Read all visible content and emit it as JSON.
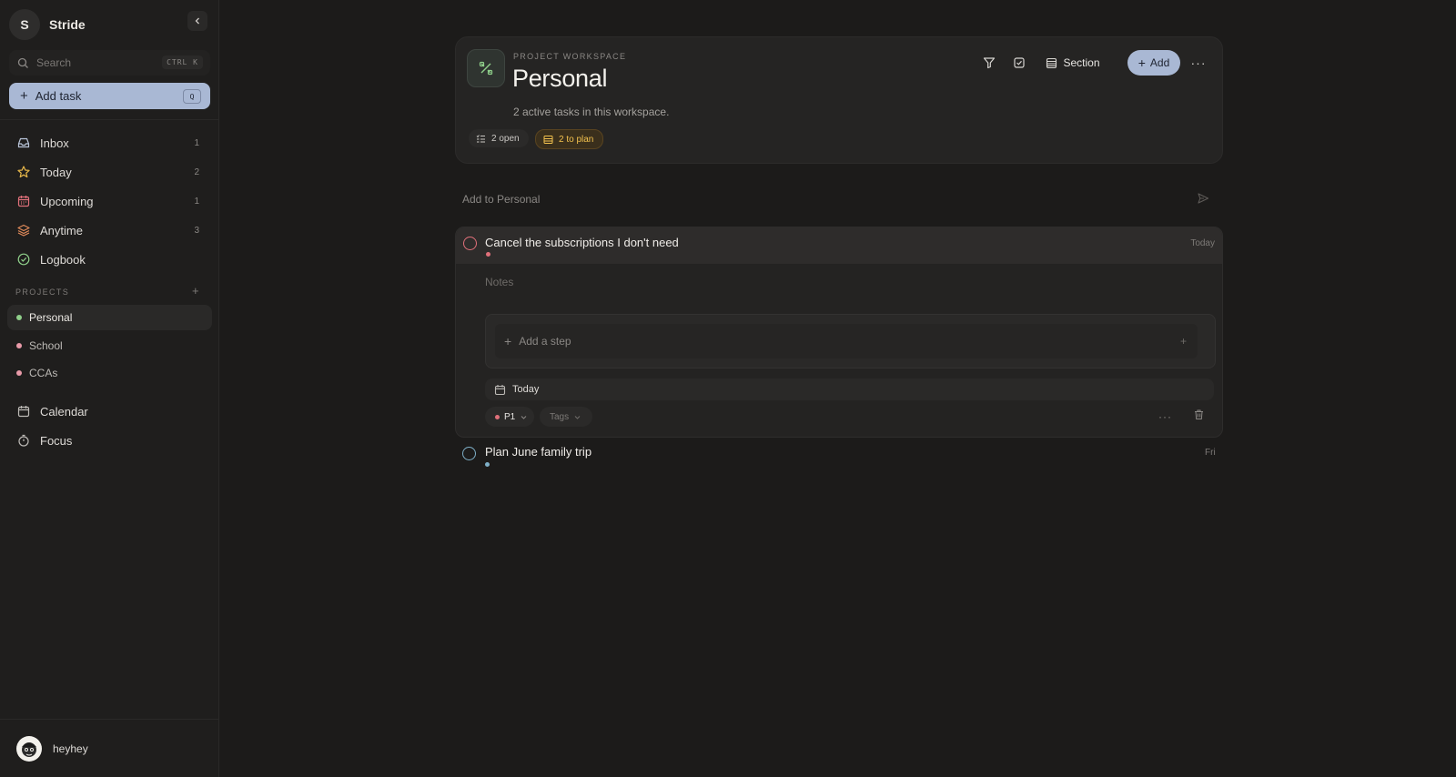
{
  "app": {
    "brand_initial": "S",
    "brand_name": "Stride"
  },
  "search": {
    "placeholder": "Search",
    "shortcut": "CTRL K"
  },
  "add_task": {
    "label": "Add task",
    "shortcut": "Q"
  },
  "nav": [
    {
      "label": "Inbox",
      "count": "1",
      "icon": "inbox-icon",
      "color": "#b8c4d8"
    },
    {
      "label": "Today",
      "count": "2",
      "icon": "star-icon",
      "color": "#e8b84a"
    },
    {
      "label": "Upcoming",
      "count": "1",
      "icon": "calendar-icon",
      "color": "#e0707a"
    },
    {
      "label": "Anytime",
      "count": "3",
      "icon": "layers-icon",
      "color": "#e08a5a"
    },
    {
      "label": "Logbook",
      "count": "",
      "icon": "check-circle-icon",
      "color": "#8fcf8a"
    }
  ],
  "projects_label": "PROJECTS",
  "projects": [
    {
      "label": "Personal",
      "color": "#8fcf8a",
      "active": true
    },
    {
      "label": "School",
      "color": "#e89aa8",
      "active": false
    },
    {
      "label": "CCAs",
      "color": "#e89aa8",
      "active": false
    }
  ],
  "bottom_nav": [
    {
      "label": "Calendar",
      "icon": "calendar-icon"
    },
    {
      "label": "Focus",
      "icon": "timer-icon"
    }
  ],
  "user": {
    "name": "heyhey"
  },
  "header": {
    "eyebrow": "PROJECT WORKSPACE",
    "title": "Personal",
    "subtitle": "2 active tasks in this workspace.",
    "chip_open": "2 open",
    "chip_plan": "2 to plan",
    "section_label": "Section",
    "add_label": "Add"
  },
  "quick_add": {
    "placeholder": "Add to Personal"
  },
  "tasks": [
    {
      "title": "Cancel the subscriptions I don't need",
      "date": "Today",
      "priority_color": "#e0707a",
      "notes_placeholder": "Notes",
      "add_step_label": "Add a step",
      "date_label": "Today",
      "priority_label": "P1",
      "tags_label": "Tags"
    },
    {
      "title": "Plan June family trip",
      "date": "Fri",
      "priority_color": "#7fb0c8"
    }
  ],
  "colors": {
    "accent": "#a9b8d4",
    "plan_chip": "#f2c14e",
    "background": "#1c1b1a"
  }
}
